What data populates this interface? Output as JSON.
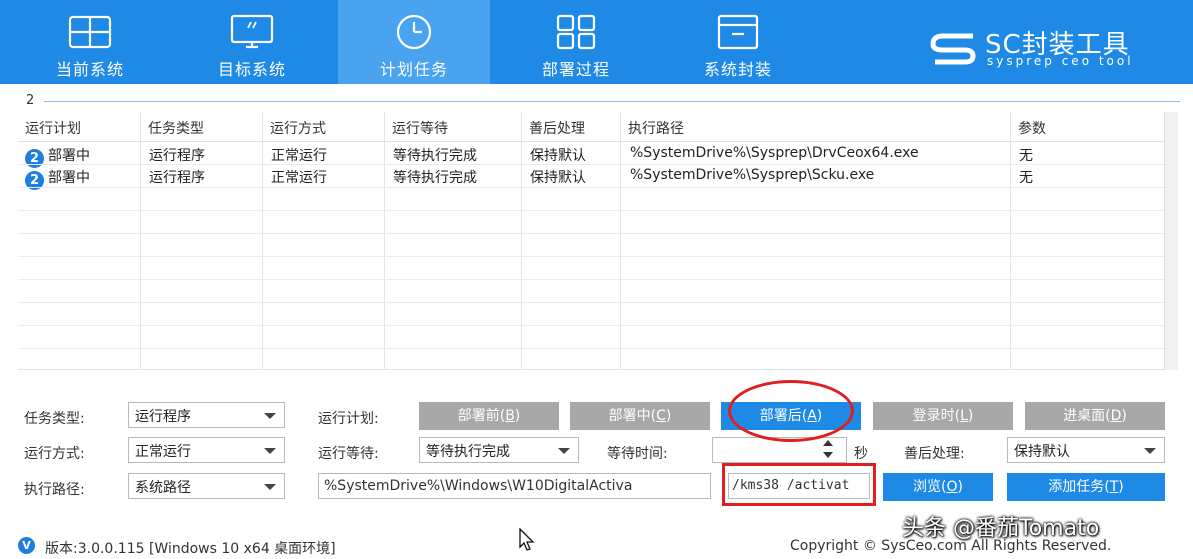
{
  "nav": {
    "tabs": [
      {
        "label": "当前系统",
        "icon": "windows-icon"
      },
      {
        "label": "目标系统",
        "icon": "monitor-icon"
      },
      {
        "label": "计划任务",
        "icon": "clock-icon",
        "active": true
      },
      {
        "label": "部署过程",
        "icon": "grid-icon"
      },
      {
        "label": "系统封装",
        "icon": "package-icon"
      }
    ]
  },
  "brand": {
    "name": "SC封装工具",
    "tagline": "sysprep ceo tool"
  },
  "group": {
    "caption": "2"
  },
  "table": {
    "headers": [
      "运行计划",
      "任务类型",
      "运行方式",
      "运行等待",
      "善后处理",
      "执行路径",
      "参数"
    ],
    "rows": [
      {
        "badge": "2",
        "plan": "部署中",
        "type": "运行程序",
        "mode": "正常运行",
        "wait": "等待执行完成",
        "after": "保持默认",
        "path": "%SystemDrive%\\Sysprep\\DrvCeox64.exe",
        "param": "无"
      },
      {
        "badge": "2",
        "plan": "部署中",
        "type": "运行程序",
        "mode": "正常运行",
        "wait": "等待执行完成",
        "after": "保持默认",
        "path": "%SystemDrive%\\Sysprep\\Scku.exe",
        "param": "无"
      }
    ]
  },
  "form": {
    "task_type_label": "任务类型:",
    "task_type_value": "运行程序",
    "run_plan_label": "运行计划:",
    "plan_buttons": [
      {
        "text": "部署前(",
        "key": "B",
        "tail": ")",
        "style": "gray"
      },
      {
        "text": "部署中(",
        "key": "C",
        "tail": ")",
        "style": "gray"
      },
      {
        "text": "部署后(",
        "key": "A",
        "tail": ")",
        "style": "blue"
      },
      {
        "text": "登录时(",
        "key": "L",
        "tail": ")",
        "style": "gray"
      },
      {
        "text": "进桌面(",
        "key": "D",
        "tail": ")",
        "style": "gray"
      }
    ],
    "run_mode_label": "运行方式:",
    "run_mode_value": "正常运行",
    "run_wait_label": "运行等待:",
    "run_wait_value": "等待执行完成",
    "wait_time_label": "等待时间:",
    "wait_time_value": "",
    "wait_time_unit": "秒",
    "after_label": "善后处理:",
    "after_value": "保持默认",
    "exec_path_label": "执行路径:",
    "exec_path_type": "系统路径",
    "exec_path_value": "%SystemDrive%\\Windows\\W10DigitalActiva",
    "params_value": "/kms38 /activat",
    "browse_button": {
      "text": "浏览(",
      "key": "O",
      "tail": ")"
    },
    "add_task_button": {
      "text": "添加任务(",
      "key": "T",
      "tail": ")"
    }
  },
  "status": {
    "version": "版本:3.0.0.115 [Windows 10 x64 桌面环境]",
    "copyright": "Copyright © SysCeo.com All Rights Reserved."
  },
  "watermark": "头条 @番茄Tomato",
  "colors": {
    "accent": "#1e8ae6",
    "active_tab": "#4aa3ee",
    "annotation_red": "#e02020",
    "button_gray": "#a8a8a8"
  }
}
